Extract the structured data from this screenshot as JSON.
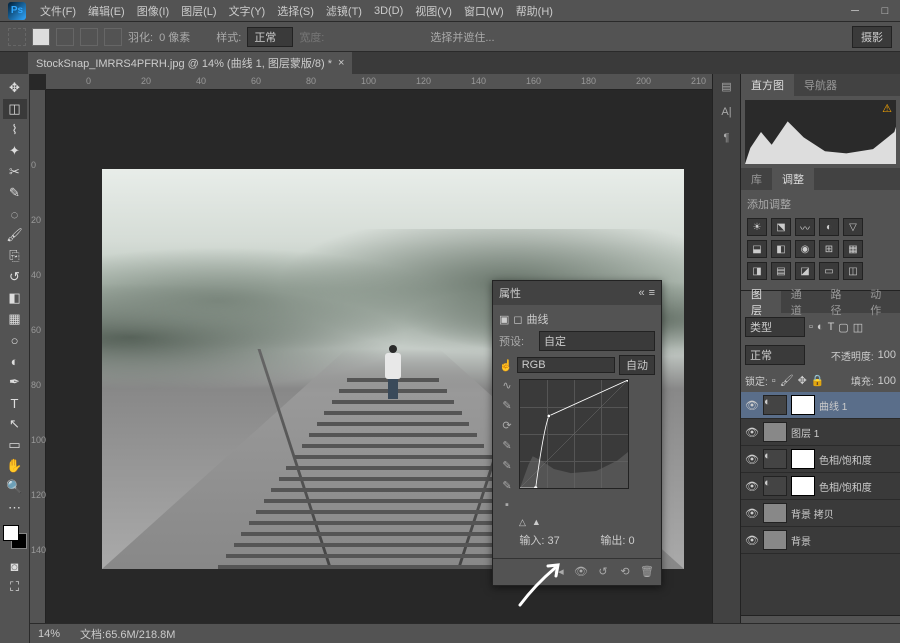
{
  "menubar": {
    "items": [
      "文件(F)",
      "编辑(E)",
      "图像(I)",
      "图层(L)",
      "文字(Y)",
      "选择(S)",
      "滤镜(T)",
      "3D(D)",
      "视图(V)",
      "窗口(W)",
      "帮助(H)"
    ]
  },
  "optionsbar": {
    "feather_label": "羽化:",
    "feather_value": "0 像素",
    "style_label": "样式:",
    "style_value": "正常",
    "width_label": "宽度:",
    "select_subject": "选择并遮住...",
    "workspace": "摄影"
  },
  "document": {
    "tab_title": "StockSnap_IMRRS4PFRH.jpg @ 14% (曲线 1, 图层蒙版/8) *"
  },
  "ruler_marks_h": [
    "0",
    "20",
    "40",
    "60",
    "80",
    "100",
    "120",
    "140",
    "160",
    "180",
    "200",
    "210"
  ],
  "ruler_marks_v": [
    "0",
    "20",
    "40",
    "60",
    "80",
    "100",
    "120",
    "140"
  ],
  "panels": {
    "histogram_tab": "直方图",
    "navigator_tab": "导航器",
    "library_tab": "库",
    "adjustments_tab": "调整",
    "adjustments_title": "添加调整",
    "layers_tab": "图层",
    "channels_tab": "通道",
    "paths_tab": "路径",
    "actions_tab": "动作",
    "layer_kind": "类型",
    "blend_mode": "正常",
    "opacity_label": "不透明度:",
    "opacity_value": "100",
    "lock_label": "锁定:",
    "fill_label": "填充:",
    "fill_value": "100",
    "layers": [
      {
        "name": "曲线 1",
        "active": true,
        "adj": true
      },
      {
        "name": "图层 1",
        "active": false,
        "adj": false
      },
      {
        "name": "色相/饱和度",
        "active": false,
        "adj": true
      },
      {
        "name": "色相/饱和度",
        "active": false,
        "adj": true
      },
      {
        "name": "背景 拷贝",
        "active": false,
        "adj": false
      },
      {
        "name": "背景",
        "active": false,
        "adj": false
      }
    ]
  },
  "properties": {
    "title": "属性",
    "subtitle": "曲线",
    "preset_label": "预设:",
    "preset_value": "自定",
    "channel_value": "RGB",
    "auto_label": "自动",
    "input_label": "输入:",
    "input_value": "37",
    "output_label": "输出:",
    "output_value": "0"
  },
  "statusbar": {
    "zoom": "14%",
    "doc_info": "文档:65.6M/218.8M"
  },
  "chart_data": {
    "type": "line",
    "title": "曲线",
    "xlabel": "输入",
    "ylabel": "输出",
    "xlim": [
      0,
      255
    ],
    "ylim": [
      0,
      255
    ],
    "series": [
      {
        "name": "RGB",
        "values": [
          [
            0,
            0
          ],
          [
            37,
            0
          ],
          [
            68,
            170
          ],
          [
            255,
            255
          ]
        ]
      }
    ],
    "histogram_backdrop": true
  }
}
